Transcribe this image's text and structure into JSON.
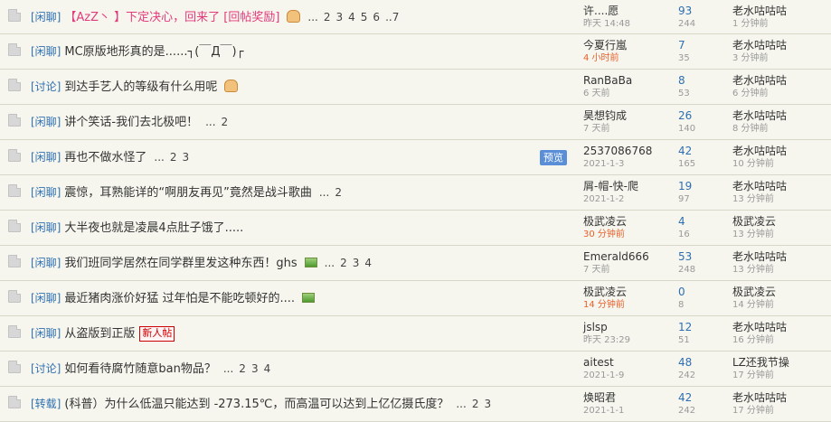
{
  "threads": [
    {
      "category": "[闲聊]",
      "title": "【AzZ丶 】下定决心，回来了 [回帖奖励]",
      "highlight": true,
      "thumb": true,
      "pages": [
        "...",
        "2",
        "3",
        "4",
        "5",
        "6",
        "..7"
      ],
      "author": "许....愿",
      "author_time": "昨天 14:48",
      "author_time_new": false,
      "replies": "93",
      "views": "244",
      "last_user": "老水咕咕咕",
      "last_time": "1 分钟前"
    },
    {
      "category": "[闲聊]",
      "title": "MC原版地形真的是......┐(￣Д￣)┌",
      "author": "今夏行嵐",
      "author_time": "4 小时前",
      "author_time_new": true,
      "replies": "7",
      "views": "35",
      "last_user": "老水咕咕咕",
      "last_time": "3 分钟前"
    },
    {
      "category": "[讨论]",
      "title": "到达手艺人的等级有什么用呢",
      "thumb": true,
      "author": "RanBaBa",
      "author_time": "6 天前",
      "author_time_new": false,
      "replies": "8",
      "views": "53",
      "last_user": "老水咕咕咕",
      "last_time": "6 分钟前"
    },
    {
      "category": "[闲聊]",
      "title": "讲个笑话-我们去北极吧！",
      "pages": [
        "...",
        "2"
      ],
      "author": "昊想钧成",
      "author_time": "7 天前",
      "author_time_new": false,
      "replies": "26",
      "views": "140",
      "last_user": "老水咕咕咕",
      "last_time": "8 分钟前"
    },
    {
      "category": "[闲聊]",
      "title": "再也不做水怪了",
      "pages": [
        "...",
        "2",
        "3"
      ],
      "preview": "预览",
      "author": "2537086768",
      "author_time": "2021-1-3",
      "author_time_new": false,
      "replies": "42",
      "views": "165",
      "last_user": "老水咕咕咕",
      "last_time": "10 分钟前"
    },
    {
      "category": "[闲聊]",
      "title": "震惊，耳熟能详的“啊朋友再见”竟然是战斗歌曲",
      "pages": [
        "...",
        "2"
      ],
      "author": "屑-帽-快-爬",
      "author_time": "2021-1-2",
      "author_time_new": false,
      "replies": "19",
      "views": "97",
      "last_user": "老水咕咕咕",
      "last_time": "13 分钟前"
    },
    {
      "category": "[闲聊]",
      "title": "大半夜也就是凌晨4点肚子饿了.....",
      "author": "极武凌云",
      "author_time": "30 分钟前",
      "author_time_new": true,
      "replies": "4",
      "views": "16",
      "last_user": "极武凌云",
      "last_time": "13 分钟前"
    },
    {
      "category": "[闲聊]",
      "title": "我们班同学居然在同学群里发这种东西！ghs",
      "image": true,
      "pages": [
        "...",
        "2",
        "3",
        "4"
      ],
      "author": "Emerald666",
      "author_time": "7 天前",
      "author_time_new": false,
      "replies": "53",
      "views": "248",
      "last_user": "老水咕咕咕",
      "last_time": "13 分钟前"
    },
    {
      "category": "[闲聊]",
      "title": "最近猪肉涨价好猛 过年怕是不能吃顿好的....",
      "image": true,
      "author": "极武凌云",
      "author_time": "14 分钟前",
      "author_time_new": true,
      "replies": "0",
      "views": "8",
      "last_user": "极武凌云",
      "last_time": "14 分钟前"
    },
    {
      "category": "[闲聊]",
      "title": "从盗版到正版",
      "new_badge": "新人帖",
      "author": "jslsp",
      "author_time": "昨天 23:29",
      "author_time_new": false,
      "replies": "12",
      "views": "51",
      "last_user": "老水咕咕咕",
      "last_time": "16 分钟前"
    },
    {
      "category": "[讨论]",
      "title": "如何看待腐竹随意ban物品？",
      "pages": [
        "...",
        "2",
        "3",
        "4"
      ],
      "author": "aitest",
      "author_time": "2021-1-9",
      "author_time_new": false,
      "replies": "48",
      "views": "242",
      "last_user": "LZ还我节操",
      "last_time": "17 分钟前"
    },
    {
      "category": "[转载]",
      "title": "(科普）为什么低温只能达到 -273.15℃，而高温可以达到上亿亿摄氏度？",
      "pages": [
        "...",
        "2",
        "3"
      ],
      "author": "焕昭君",
      "author_time": "2021-1-1",
      "author_time_new": false,
      "replies": "42",
      "views": "242",
      "last_user": "老水咕咕咕",
      "last_time": "17 分钟前"
    }
  ],
  "colors": {
    "background": "#f6f6ee",
    "category": "#2e6fb2",
    "highlight_title": "#e33a7c",
    "new_time": "#e8602c",
    "preview_badge": "#5a8fd8"
  }
}
